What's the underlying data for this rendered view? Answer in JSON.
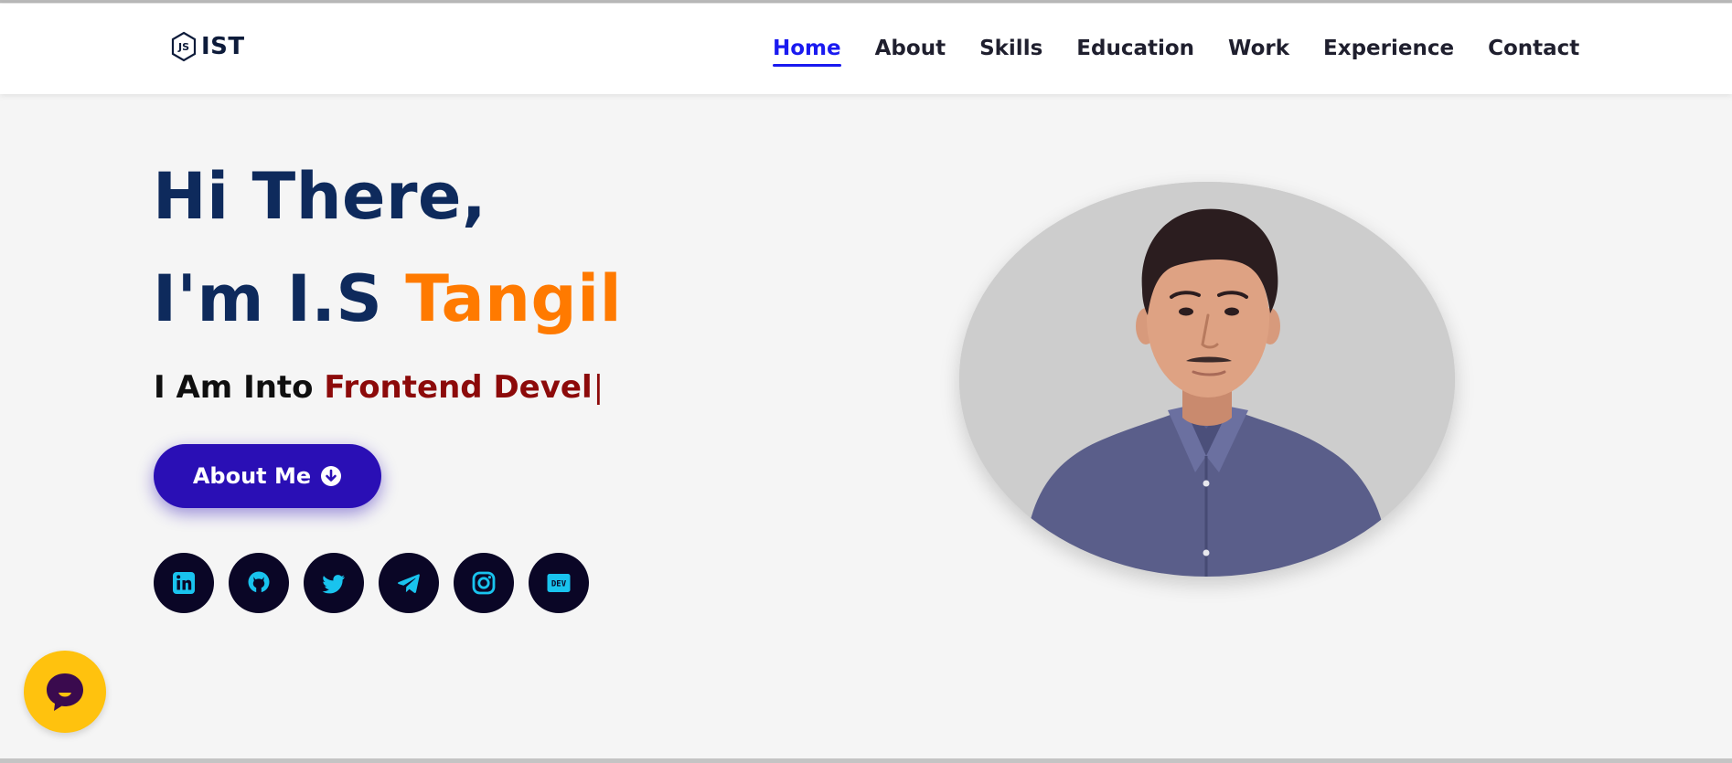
{
  "brand": {
    "text": "IST",
    "icon": "js-hexagon-logo-icon"
  },
  "nav": {
    "links": [
      {
        "label": "Home",
        "active": true
      },
      {
        "label": "About",
        "active": false
      },
      {
        "label": "Skills",
        "active": false
      },
      {
        "label": "Education",
        "active": false
      },
      {
        "label": "Work",
        "active": false
      },
      {
        "label": "Experience",
        "active": false
      },
      {
        "label": "Contact",
        "active": false
      }
    ]
  },
  "hero": {
    "greeting": "Hi There,",
    "intro_prefix": "I'm I.S ",
    "intro_name": "Tangil",
    "typing_prefix": "I Am Into ",
    "typing_text": "Frontend Devel",
    "typing_cursor": "|",
    "button_label": "About Me",
    "button_icon": "arrow-down-circle-icon"
  },
  "socials": [
    {
      "name": "linkedin-icon"
    },
    {
      "name": "github-icon"
    },
    {
      "name": "twitter-icon"
    },
    {
      "name": "telegram-icon"
    },
    {
      "name": "instagram-icon"
    },
    {
      "name": "dev-icon",
      "label": "DEV"
    }
  ],
  "portrait": {
    "alt": "profile-photo"
  },
  "chat": {
    "icon": "chat-bubble-icon"
  },
  "colors": {
    "accent_orange": "#ff7a00",
    "heading_navy": "#0e2a5c",
    "typed_red": "#8c0a0a",
    "button_indigo": "#2a0fb5",
    "nav_active_blue": "#1a1af0",
    "social_icon_cyan": "#19c3ee",
    "chat_yellow": "#ffc20e"
  }
}
